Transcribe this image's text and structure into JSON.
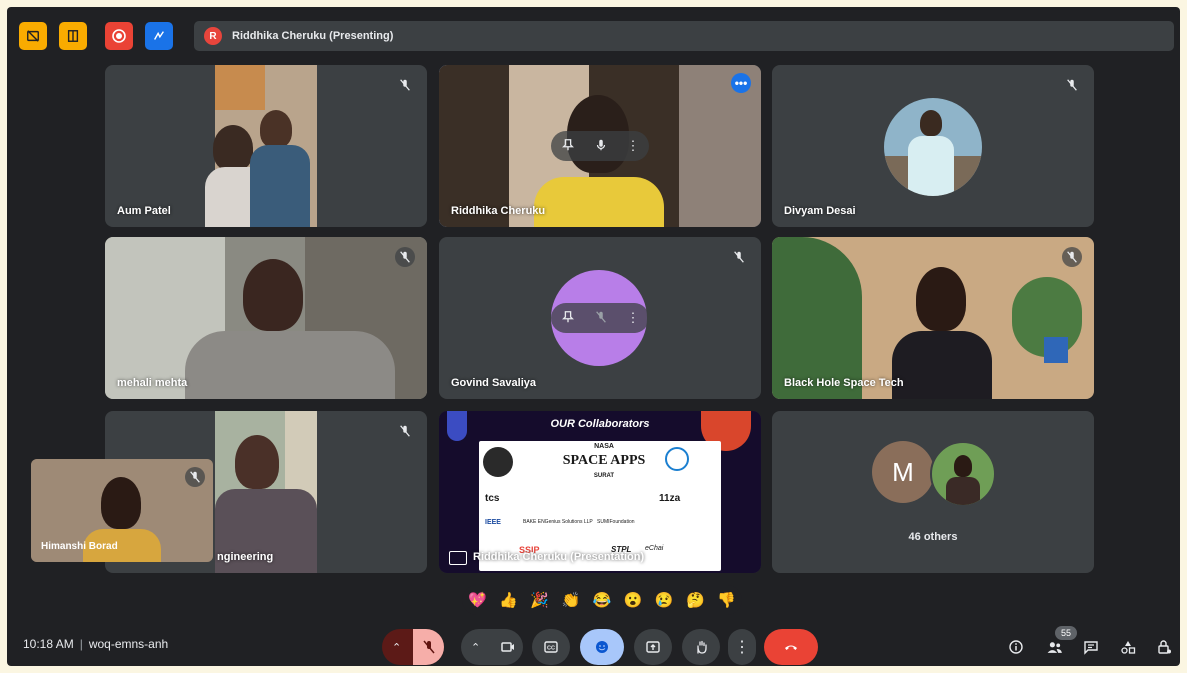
{
  "presenting": {
    "avatar_letter": "R",
    "label": "Riddhika Cheruku (Presenting)"
  },
  "top_buttons": [
    {
      "icon": "layout-off-icon",
      "color": "#f9ab00"
    },
    {
      "icon": "panel-icon",
      "color": "#f9ab00"
    },
    {
      "icon": "record-icon",
      "color": "#ea4335"
    },
    {
      "icon": "whiteboard-icon",
      "color": "#1a73e8"
    }
  ],
  "tiles": [
    {
      "name": "Aum Patel"
    },
    {
      "name": "Riddhika Cheruku"
    },
    {
      "name": "Divyam Desai"
    },
    {
      "name": "mehali mehta"
    },
    {
      "name": "Govind Savaliya"
    },
    {
      "name": "Black Hole Space Tech"
    },
    {
      "name": "ngineering"
    },
    {
      "name": "Riddhika Cheruku (Presentation)"
    },
    {
      "name": "46 others",
      "avatar_letter": "M"
    }
  ],
  "self_view": {
    "name": "Himanshi Borad"
  },
  "presentation": {
    "heading": "OUR Collaborators",
    "logo_main": "SPACE APPS",
    "logo_top": "NASA",
    "logo_city": "SURAT",
    "partners": [
      "tcs",
      "11za",
      "IEEE",
      "BAKE ENGenius Solutions LLP",
      "SUMIFoundation",
      "SSIP",
      "STPL",
      "eChai"
    ]
  },
  "reactions": [
    "💖",
    "👍",
    "🎉",
    "👏",
    "😂",
    "😮",
    "😢",
    "🤔",
    "👎"
  ],
  "bottom": {
    "time": "10:18 AM",
    "meeting_code": "woq-emns-anh",
    "participant_count": "55"
  },
  "colors": {
    "background": "#202124",
    "tile": "#3c4043",
    "accent": "#8ab4f8",
    "danger": "#ea4335"
  }
}
